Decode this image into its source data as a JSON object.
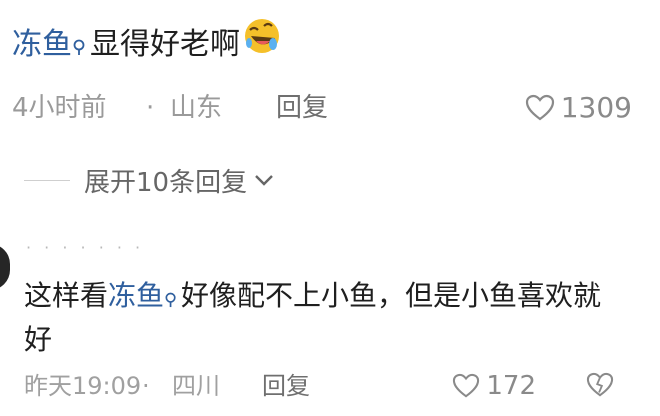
{
  "comment1": {
    "mention": "冻鱼",
    "text": "显得好老啊",
    "emoji_icon": "rolling-laugh-emoji",
    "time": "4小时前",
    "separator": "·",
    "location": "山东",
    "reply_label": "回复",
    "like_count": "1309",
    "expand_label": "展开10条回复"
  },
  "comment2": {
    "username_masked": "· · · · · · ·",
    "text_before": "这样看",
    "mention": "冻鱼",
    "text_after": "好像配不上小鱼，但是小鱼喜欢就好",
    "time": "昨天19:09",
    "separator": "·",
    "location": "四川",
    "reply_label": "回复",
    "like_count": "172"
  },
  "colors": {
    "mention": "#2f5f9e",
    "text": "#1f1f1f",
    "meta": "#9a9a9a",
    "emoji": "#f5c02a"
  }
}
